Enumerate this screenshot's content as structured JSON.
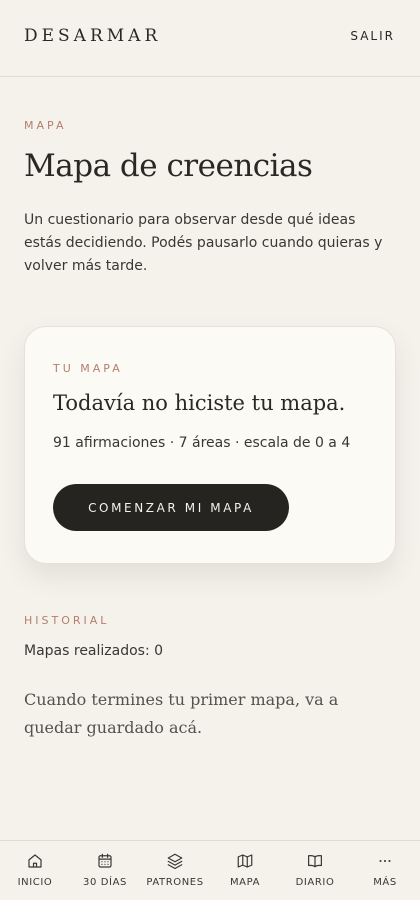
{
  "header": {
    "brand": "DESARMAR",
    "logout_label": "SALIR"
  },
  "intro": {
    "eyebrow": "MAPA",
    "title": "Mapa de creencias",
    "description": "Un cuestionario para observar desde qué ideas estás decidiendo. Podés pausarlo cuando quieras y volver más tarde."
  },
  "card": {
    "eyebrow": "TU MAPA",
    "title": "Todavía no hiciste tu mapa.",
    "meta": "91 afirmaciones · 7 áreas · escala de 0 a 4",
    "button_label": "COMENZAR MI MAPA"
  },
  "history": {
    "eyebrow": "HISTORIAL",
    "count": "Mapas realizados: 0",
    "empty_message": "Cuando termines tu primer mapa, va a quedar guardado acá."
  },
  "nav": {
    "items": [
      {
        "label": "INICIO",
        "icon": "home-icon"
      },
      {
        "label": "30 DÍAS",
        "icon": "calendar-icon"
      },
      {
        "label": "PATRONES",
        "icon": "layers-icon"
      },
      {
        "label": "MAPA",
        "icon": "map-icon"
      },
      {
        "label": "DIARIO",
        "icon": "book-icon"
      },
      {
        "label": "MÁS",
        "icon": "more-icon"
      }
    ]
  },
  "colors": {
    "background": "#F5F2EC",
    "accent": "#B47E6F",
    "primary_button": "#262421",
    "card": "#FBFAF5"
  }
}
